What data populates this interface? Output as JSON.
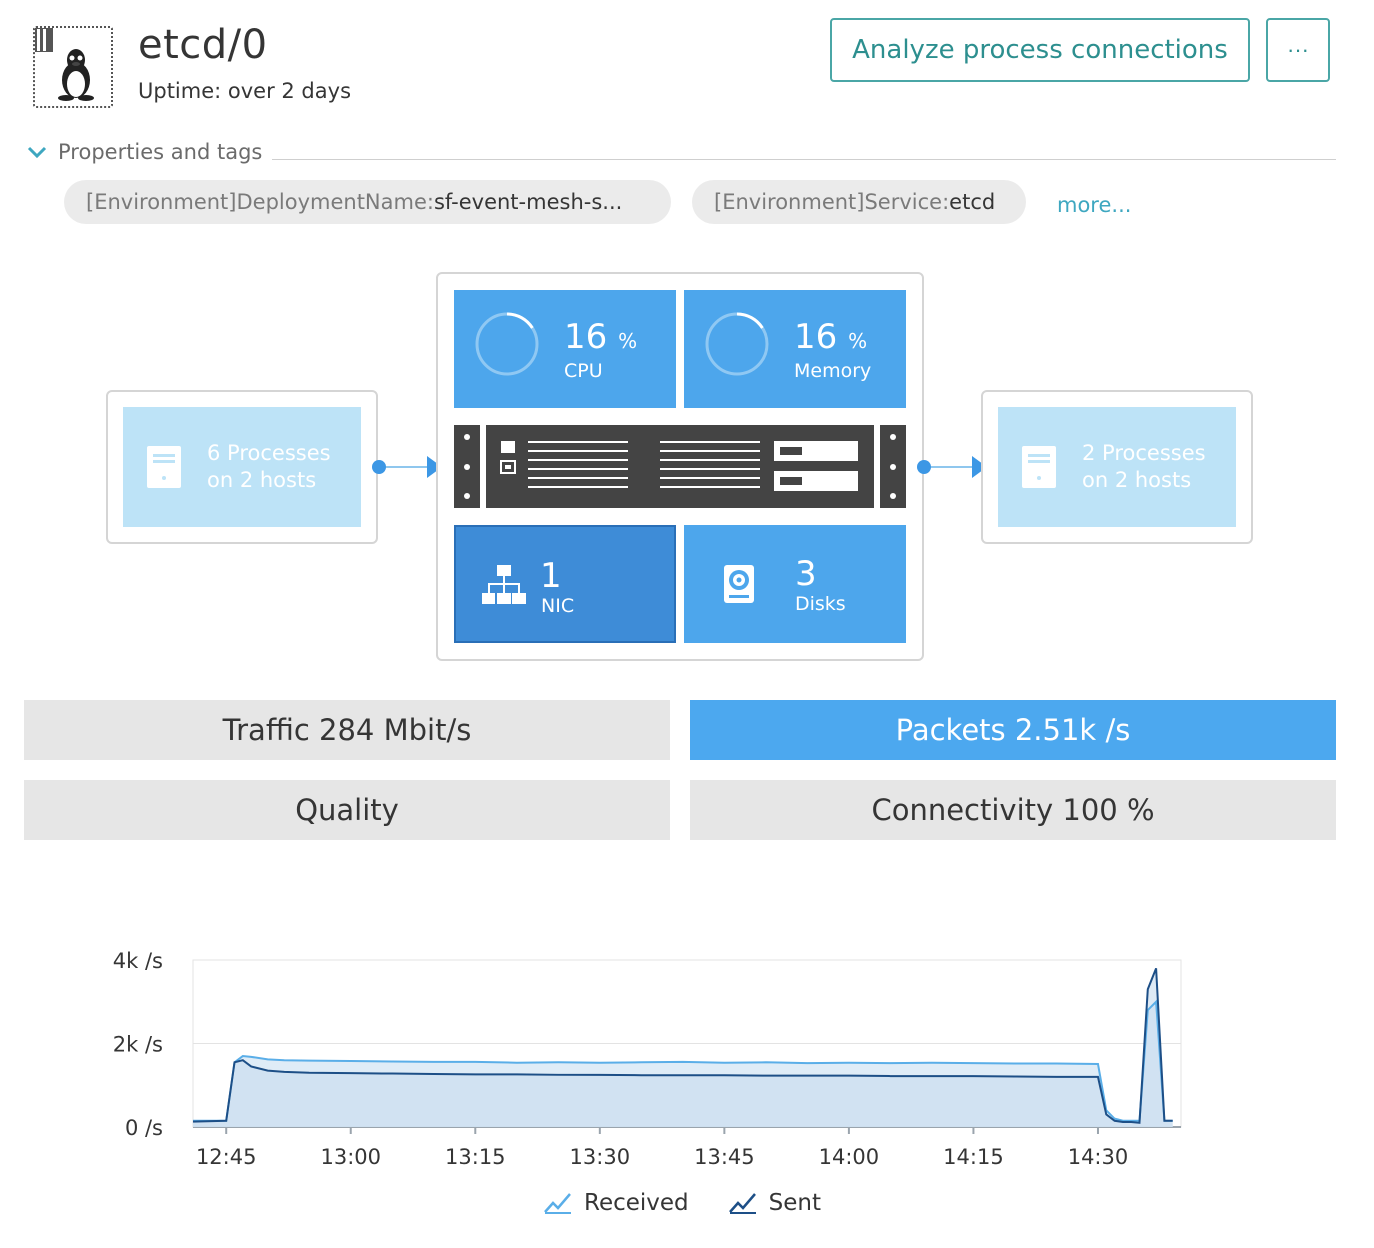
{
  "header": {
    "title": "etcd/0",
    "uptime": "Uptime: over 2 days",
    "analyze_label": "Analyze process connections",
    "more_label": "···"
  },
  "properties": {
    "label": "Properties and tags",
    "tags": [
      {
        "key": "[Environment]DeploymentName: ",
        "value": "sf-event-mesh-s..."
      },
      {
        "key": "[Environment]Service: ",
        "value": "etcd"
      }
    ],
    "more_label": "more..."
  },
  "topology": {
    "incoming": {
      "line1": "6 Processes",
      "line2": "on 2 hosts"
    },
    "outgoing": {
      "line1": "2 Processes",
      "line2": "on 2 hosts"
    },
    "cpu": {
      "value": "16",
      "unit": "%",
      "label": "CPU",
      "percent": 16
    },
    "memory": {
      "value": "16",
      "unit": "%",
      "label": "Memory",
      "percent": 16
    },
    "nic": {
      "value": "1",
      "label": "NIC"
    },
    "disks": {
      "value": "3",
      "label": "Disks"
    }
  },
  "metrics": {
    "traffic": "Traffic 284 Mbit/s",
    "packets": "Packets 2.51k /s",
    "quality": "Quality",
    "connectivity": "Connectivity 100 %",
    "selected": "packets"
  },
  "colors": {
    "accent": "#4ca8ef",
    "received": "#5aaee8",
    "sent": "#1d4f87"
  },
  "chart_data": {
    "type": "area",
    "title": "",
    "xlabel": "",
    "ylabel": "",
    "y_ticks": [
      "4k /s",
      "2k /s",
      "0 /s"
    ],
    "y_tick_values": [
      4000,
      2000,
      0
    ],
    "ylim": [
      0,
      4000
    ],
    "x_ticks": [
      "12:45",
      "13:00",
      "13:15",
      "13:30",
      "13:45",
      "14:00",
      "14:15",
      "14:30"
    ],
    "x_tick_values": [
      45,
      60,
      75,
      90,
      105,
      120,
      135,
      150
    ],
    "xlim": [
      41,
      160
    ],
    "grid": true,
    "legend_position": "bottom",
    "series": [
      {
        "name": "Received",
        "x": [
          41,
          45,
          46,
          47,
          48,
          50,
          52,
          55,
          60,
          65,
          70,
          75,
          80,
          85,
          90,
          95,
          100,
          105,
          110,
          115,
          120,
          125,
          130,
          135,
          140,
          145,
          150,
          151,
          152,
          153,
          154,
          155,
          156,
          157,
          158,
          159
        ],
        "values": [
          150,
          150,
          1550,
          1700,
          1680,
          1620,
          1600,
          1590,
          1580,
          1570,
          1560,
          1560,
          1540,
          1550,
          1540,
          1550,
          1560,
          1540,
          1550,
          1530,
          1540,
          1530,
          1540,
          1530,
          1520,
          1520,
          1510,
          400,
          200,
          150,
          150,
          150,
          2800,
          3000,
          150,
          150
        ]
      },
      {
        "name": "Sent",
        "x": [
          41,
          45,
          46,
          47,
          48,
          50,
          52,
          55,
          60,
          65,
          70,
          75,
          80,
          85,
          90,
          95,
          100,
          105,
          110,
          115,
          120,
          125,
          130,
          135,
          140,
          145,
          150,
          151,
          152,
          153,
          154,
          155,
          156,
          157,
          158,
          159
        ],
        "values": [
          130,
          150,
          1550,
          1600,
          1450,
          1350,
          1320,
          1300,
          1290,
          1280,
          1270,
          1260,
          1260,
          1250,
          1250,
          1240,
          1240,
          1240,
          1230,
          1230,
          1230,
          1220,
          1220,
          1220,
          1210,
          1200,
          1200,
          300,
          150,
          120,
          120,
          100,
          3300,
          3800,
          150,
          150
        ]
      }
    ]
  }
}
